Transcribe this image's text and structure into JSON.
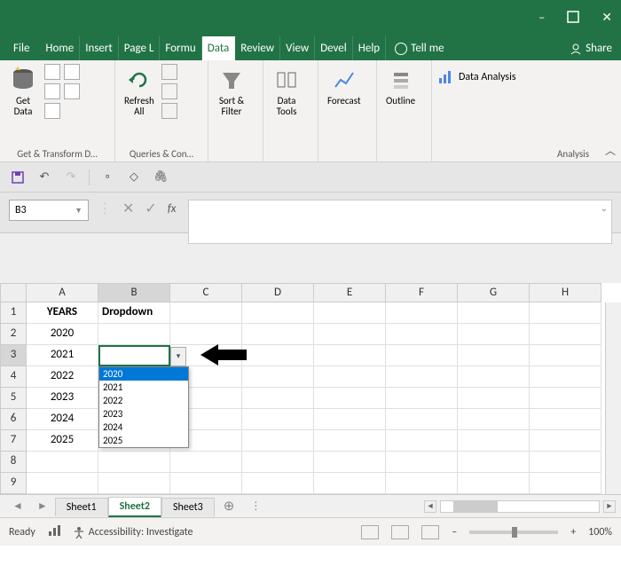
{
  "window": {
    "minimize": "–",
    "maximize": "□",
    "close": "✕"
  },
  "menu": {
    "file": "File",
    "tabs": [
      "Home",
      "Insert",
      "Page L",
      "Formu",
      "Data",
      "Review",
      "View",
      "Devel",
      "Help"
    ],
    "active_index": 4,
    "tellme": "Tell me",
    "share": "Share"
  },
  "ribbon": {
    "groups": [
      {
        "label": "Get & Transform D…",
        "big": "Get\nData"
      },
      {
        "label": "Queries & Con…",
        "big": "Refresh\nAll"
      },
      {
        "label": "",
        "big": "Sort &\nFilter"
      },
      {
        "label": "",
        "big": "Data\nTools"
      },
      {
        "label": "",
        "big": "Forecast"
      },
      {
        "label": "",
        "big": "Outline"
      },
      {
        "label": "Analysis",
        "text": "Data Analysis"
      }
    ]
  },
  "namebox": "B3",
  "fx_label": "fx",
  "columns": [
    "A",
    "B",
    "C",
    "D",
    "E",
    "F",
    "G",
    "H"
  ],
  "rows": [
    "1",
    "2",
    "3",
    "4",
    "5",
    "6",
    "7",
    "8",
    "9"
  ],
  "headers": {
    "A": "YEARS",
    "B": "Dropdown"
  },
  "years": [
    "2020",
    "2021",
    "2022",
    "2023",
    "2024",
    "2025"
  ],
  "dropdown_options": [
    "2020",
    "2021",
    "2022",
    "2023",
    "2024",
    "2025"
  ],
  "dropdown_highlight_index": 0,
  "sheets": {
    "tabs": [
      "Sheet1",
      "Sheet2",
      "Sheet3"
    ],
    "active_index": 1,
    "add": "+"
  },
  "status": {
    "ready": "Ready",
    "accessibility": "Accessibility: Investigate",
    "zoom": "100%",
    "minus": "–",
    "plus": "+"
  },
  "chart_data": null
}
